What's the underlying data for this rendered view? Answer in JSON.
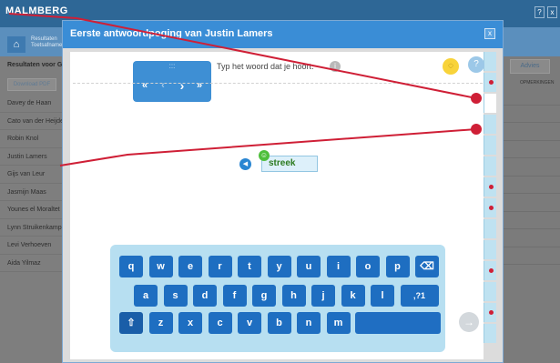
{
  "app": {
    "brand": "MALMBERG",
    "subtitle": "",
    "help_btn": "?",
    "close_btn": "x"
  },
  "breadcrumb": {
    "line1": "Resultaten",
    "line2": "Toetsafname"
  },
  "left_panel": {
    "title": "Resultaten voor G",
    "download_label": "Download PDF",
    "students": [
      "Davey de Haan",
      "Cato van der Heijde",
      "Robin Knol",
      "Justin Lamers",
      "Gijs van Leur",
      "Jasmijn Maas",
      "Younes el Moraltet",
      "Lynn Struikenkamp",
      "Levi Verhoeven",
      "Aida Yilmaz"
    ]
  },
  "right_panel": {
    "advies_label": "Advies",
    "opmerkingen_label": "OPMERKINGEN"
  },
  "modal": {
    "title": "Eerste antwoordpoging van Justin Lamers",
    "close_icon": "x"
  },
  "exercise": {
    "nav_grip": ":::",
    "nav_first": "«",
    "nav_prev": "‹",
    "nav_next": "›",
    "nav_last": "»",
    "instruction": "Typ het woord dat je hoort.",
    "answer": "streek",
    "side_tabs_with_dot": [
      1,
      6,
      7,
      10,
      12
    ]
  },
  "keyboard": {
    "row1": [
      "q",
      "w",
      "e",
      "r",
      "t",
      "y",
      "u",
      "i",
      "o",
      "p",
      "⌫"
    ],
    "row2": [
      "a",
      "s",
      "d",
      "f",
      "g",
      "h",
      "j",
      "k",
      "l",
      ",?1"
    ],
    "row3": [
      "⇧",
      "z",
      "x",
      "c",
      "v",
      "b",
      "n",
      "m"
    ],
    "enter": "→"
  },
  "colors": {
    "title_bar": "#3a8dd6",
    "key": "#1e6ec1",
    "annotation": "#cf1f36",
    "correct": "#4fbf3c"
  }
}
